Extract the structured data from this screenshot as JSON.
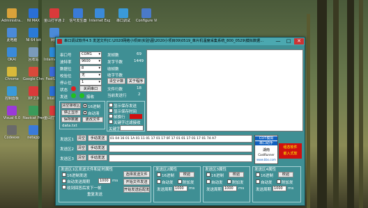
{
  "desktop": {
    "icons": [
      {
        "label": "Administra...",
        "color": "#d9a23a"
      },
      {
        "label": "NI MAX",
        "color": "#2a6fd6"
      },
      {
        "label": "金山打字通 2016",
        "color": "#d93a3a"
      },
      {
        "label": "信号发生器",
        "color": "#3a7bd9"
      },
      {
        "label": "Internet Explorer",
        "color": "#3a8ad9"
      },
      {
        "label": "串口调试",
        "color": "#3a9ad9"
      },
      {
        "label": "Configure Virtual...",
        "color": "#4a7ac9"
      },
      {
        "label": "此电脑",
        "color": "#4a8ad9"
      },
      {
        "label": "NI 64 bit",
        "color": "#2a7ad6"
      },
      {
        "label": "网络",
        "color": "#4a8ad9"
      },
      {
        "label": "OKAI",
        "color": "#3a8ad9"
      },
      {
        "label": "回收站",
        "color": "#7a9aba"
      },
      {
        "label": "Internet Explorer",
        "color": "#2a8ad9"
      },
      {
        "label": "Chrome",
        "color": "#d9b93a"
      },
      {
        "label": "Google Chrome",
        "color": "#d9493a"
      },
      {
        "label": "FastStone",
        "color": "#3a6ad9"
      },
      {
        "label": "控制面板",
        "color": "#3a9ad9"
      },
      {
        "label": "XP 2.0",
        "color": "#d93a3a"
      },
      {
        "label": "Intel Poll",
        "color": "#2a6fd6"
      },
      {
        "label": "Visual 6.0",
        "color": "#9a3ad9"
      },
      {
        "label": "Navicat Premium",
        "color": "#3a9a5a"
      },
      {
        "label": "金山打字2016",
        "color": "#d93a3a"
      },
      {
        "label": "Codeexe",
        "color": "#6a6a6a"
      },
      {
        "label": "netapp",
        "color": "#3a7ad9"
      }
    ]
  },
  "window": {
    "title": "串口调试软件4.5 发送文件[C:\\2020网络小项目\\实验\\图\\2020小项目09\\0519_单片机温度采集系统_800_0529\\模拟数据...",
    "minimize": "—",
    "maximize": "□",
    "close": "✕"
  },
  "serial": {
    "port_label": "串口号",
    "port_value": "COM1",
    "baud_label": "波特率",
    "baud_value": "9600",
    "data_label": "数据位",
    "data_value": "8",
    "parity_label": "校验位",
    "parity_value": "无",
    "stop_label": "停止位",
    "stop_value": "1",
    "state_label": "状态",
    "close_button": "关闭串口",
    "send_label": "发送",
    "recv_label": "接收"
  },
  "stats": {
    "tx_label": "发帧数",
    "tx_value": "69",
    "rx_label": "发字节数",
    "rx_value": "1449",
    "rxframes_label": "收帧数",
    "rxbytes_label": "收字节数",
    "clear_button": "清空计数",
    "about_button": "关于程序",
    "file_rows_label": "文件行数",
    "file_rows_value": "18",
    "current_row_label": "当前发送行",
    "current_row_value": "2"
  },
  "recv_controls": {
    "clear_recv": "清空接收区",
    "hex_display": "16进制",
    "stop_display": "停止显示",
    "auto_clear": "自动清",
    "save_data": "保存数据",
    "change_file": "更改文件",
    "filename": "data.txt"
  },
  "recv_options": {
    "auto_save": "显示保存发送",
    "show_time": "显示保存时间",
    "frame_sep": "帧换行",
    "stop_word_label": "关键字过滤接收",
    "keyword_label": "关键字"
  },
  "send_rows": [
    {
      "label": "发送区1",
      "clear": "清空",
      "manual": "手动发送",
      "content": "01 04 16 01 1A 01 11 01 17 01 17 0F 17 01 01 17 01 17 01 74 A7"
    },
    {
      "label": "发送区2",
      "clear": "清空",
      "manual": "手动发送",
      "content": ""
    },
    {
      "label": "发送区3",
      "clear": "清空",
      "manual": "手动发送",
      "content": ""
    }
  ],
  "ad": {
    "line1": "CDT模拟",
    "line2": "串口助手",
    "line3": "湖南",
    "line4": "CastRunner",
    "line5": "www.bbs.com",
    "line6": "组态软件",
    "line7": "嵌入式软"
  },
  "area1": {
    "title": "发送区1区发送文件和定时属性",
    "hex_send": "16进制发送",
    "period_label": "自动发送周期",
    "period_value": "1000",
    "ms_label": "ms",
    "send_file": "选择发送文件",
    "start_file": "开始文件发送",
    "stop_file": "开始发送后配发",
    "loop_label": "收到回答后发下一帧",
    "repeat_label": "重复发送"
  },
  "area2": {
    "title": "发送区2属性",
    "hex": "16进制",
    "check": "校验",
    "auto": "自动发",
    "append": "附加发",
    "period_label": "发送周期",
    "period_value": "1000",
    "ms": "ms"
  },
  "area3": {
    "title": "发送区3属性",
    "hex": "16进制",
    "check": "校验",
    "auto": "自动发",
    "append": "附加发",
    "period_label": "发送周期",
    "period_value": "1000",
    "ms": "ms"
  },
  "area4": {
    "title": "发送区4属性",
    "hex": "16进制",
    "check": "校验",
    "auto": "自动发",
    "append": "附加发",
    "period_label": "发送周期",
    "period_value": "1000",
    "ms": "ms"
  },
  "colors": {
    "window_bg": "#3f8f94",
    "titlebar": "#4ba8b0",
    "led_red": "#e02020",
    "led_green": "#20c020",
    "ad_red": "#d01010",
    "ad_blue": "#1060c0"
  }
}
